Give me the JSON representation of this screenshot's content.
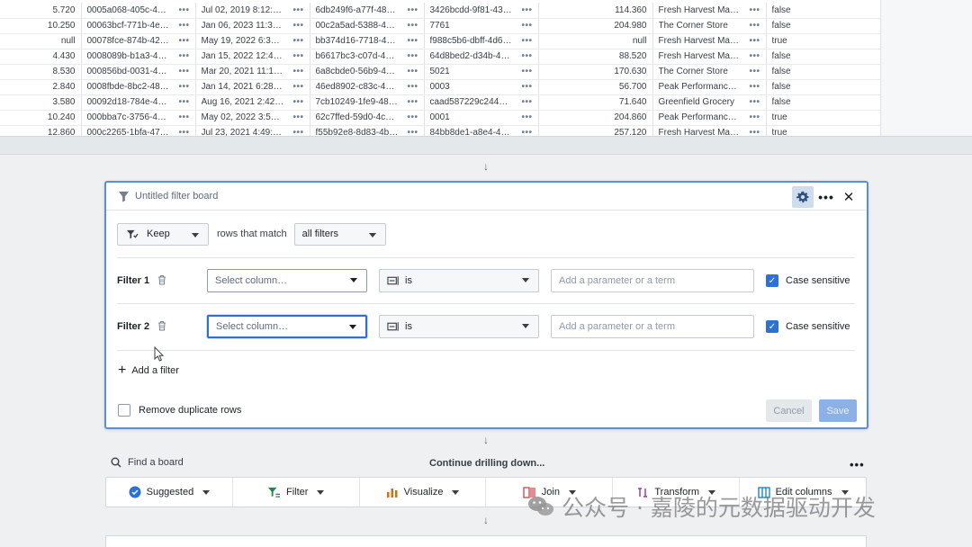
{
  "table": {
    "rows": [
      [
        "5.720",
        "0005a068-405c-4d…",
        "Jul 02, 2019 8:12:3…",
        "6db249f6-a77f-48e…",
        "3426bcdd-9f81-43…",
        "114.360",
        "Fresh Harvest Mar…",
        "false"
      ],
      [
        "10.250",
        "00063bcf-771b-4e…",
        "Jan 06, 2023 11:37…",
        "00c2a5ad-5388-4a…",
        "7761",
        "204.980",
        "The Corner Store",
        "false"
      ],
      [
        "null",
        "00078fce-874b-42…",
        "May 19, 2022 6:30:…",
        "bb374d16-7718-4…",
        "f988c5b6-dbff-4d6…",
        "null",
        "Fresh Harvest Mar…",
        "true"
      ],
      [
        "4.430",
        "0008089b-b1a3-41…",
        "Jan 15, 2022 12:49…",
        "b6617bc3-c07d-4b…",
        "64d8bed2-d34b-4…",
        "88.520",
        "Fresh Harvest Mar…",
        "false"
      ],
      [
        "8.530",
        "000856bd-0031-40…",
        "Mar 20, 2021 11:12…",
        "6a8cbde0-56b9-4d…",
        "5021",
        "170.630",
        "The Corner Store",
        "false"
      ],
      [
        "2.840",
        "0008fbde-8bc2-48…",
        "Jan 14, 2021 6:28:…",
        "46ed8902-c83c-41…",
        "0003",
        "56.700",
        "Peak Performance …",
        "false"
      ],
      [
        "3.580",
        "00092d18-784e-4c…",
        "Aug 16, 2021 2:42:…",
        "7cb10249-1fe9-48f…",
        "caad587229c2444…",
        "71.640",
        "Greenfield Grocery",
        "false"
      ],
      [
        "10.240",
        "000bba7c-3756-4a…",
        "May 02, 2022 3:51:…",
        "62c7ffed-59d0-4c1…",
        "0001",
        "204.860",
        "Peak Performance …",
        "true"
      ],
      [
        "12.860",
        "000c2265-1bfa-47…",
        "Jul 23, 2021 4:49:3…",
        "f55b92e8-8d83-4b…",
        "84bb8de1-a8e4-4…",
        "257.120",
        "Fresh Harvest Mar…",
        "true"
      ]
    ]
  },
  "board": {
    "title": "Untitled filter board",
    "keep_label": "Keep",
    "rows_that_match": "rows that match",
    "match_mode": "all filters",
    "filters": [
      {
        "label": "Filter 1",
        "column_placeholder": "Select column…",
        "operator": "is",
        "param_placeholder": "Add a parameter or a term",
        "case_label": "Case sensitive"
      },
      {
        "label": "Filter 2",
        "column_placeholder": "Select column…",
        "operator": "is",
        "param_placeholder": "Add a parameter or a term",
        "case_label": "Case sensitive"
      }
    ],
    "add_filter": "Add a filter",
    "remove_duplicates": "Remove duplicate rows",
    "cancel": "Cancel",
    "save": "Save"
  },
  "lower": {
    "find_board": "Find a board",
    "continue": "Continue drilling down...",
    "toolbar": [
      {
        "label": "Suggested",
        "icon": "check-circle-icon",
        "color": "#2d72d2"
      },
      {
        "label": "Filter",
        "icon": "filter-icon",
        "color": "#238551"
      },
      {
        "label": "Visualize",
        "icon": "bar-chart-icon",
        "color": "#c87619"
      },
      {
        "label": "Join",
        "icon": "join-icon",
        "color": "#cd4246"
      },
      {
        "label": "Transform",
        "icon": "transform-icon",
        "color": "#9d3f9d"
      },
      {
        "label": "Edit columns",
        "icon": "columns-icon",
        "color": "#147eb3"
      }
    ]
  },
  "watermark": "公众号 · 嘉陵的元数据驱动开发",
  "colors": {
    "accent": "#2d72d2",
    "board_border": "#5b8ed6",
    "save_disabled": "#8db1e6"
  }
}
